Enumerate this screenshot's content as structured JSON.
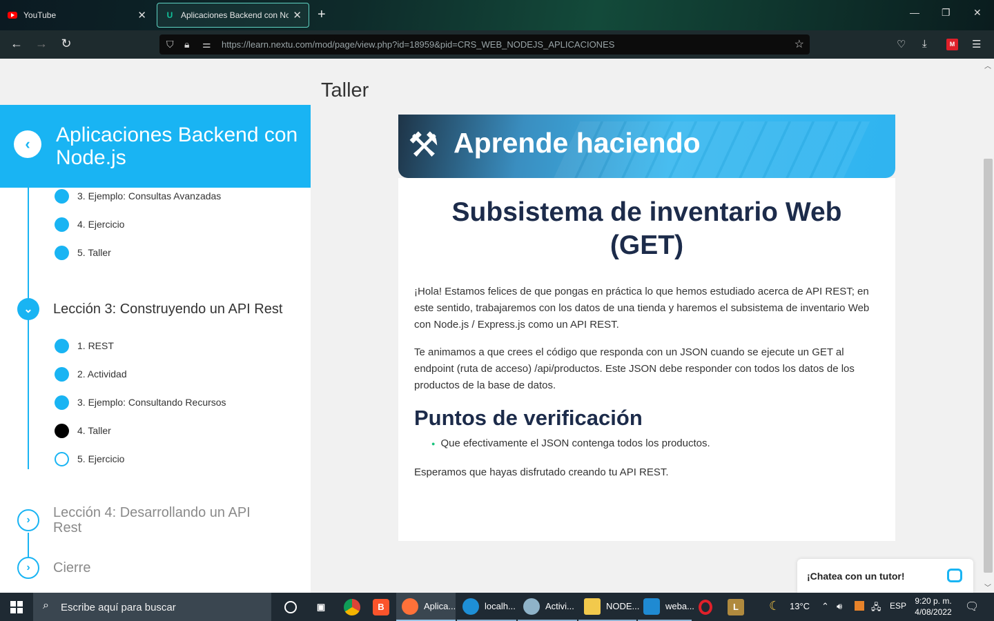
{
  "browser": {
    "tabs": [
      {
        "title": "YouTube",
        "active": false
      },
      {
        "title": "Aplicaciones Backend con Node.js",
        "active": true
      }
    ],
    "url": "https://learn.nextu.com/mod/page/view.php?id=18959&pid=CRS_WEB_NODEJS_APLICACIONES"
  },
  "page": {
    "title": "Taller"
  },
  "sidebar": {
    "course_title": "Aplicaciones Backend con Node.js",
    "prev_items": [
      {
        "label": "3. Ejemplo: Consultas Avanzadas"
      },
      {
        "label": "4. Ejercicio"
      },
      {
        "label": "5. Taller"
      }
    ],
    "lesson3": {
      "title": "Lección 3: Construyendo un API Rest",
      "items": [
        {
          "label": "1. REST",
          "state": "done"
        },
        {
          "label": "2. Actividad",
          "state": "done"
        },
        {
          "label": "3. Ejemplo: Consultando Recursos",
          "state": "done"
        },
        {
          "label": "4. Taller",
          "state": "current"
        },
        {
          "label": "5. Ejercicio",
          "state": "pending"
        }
      ]
    },
    "lesson4": {
      "title": "Lección 4: Desarrollando un API Rest"
    },
    "closing": {
      "title": "Cierre"
    }
  },
  "content": {
    "banner_title": "Aprende haciendo",
    "heading": "Subsistema de inventario Web (GET)",
    "paragraph1": "¡Hola! Estamos felices de que pongas en práctica lo que hemos estudiado acerca de API REST; en este sentido, trabajaremos con los datos de una tienda y haremos el subsistema de inventario Web con Node.js / Express.js como un API REST.",
    "paragraph2": "Te animamos a que crees el código que responda con un JSON cuando se ejecute un GET al endpoint (ruta de acceso) /api/productos. Este JSON debe responder con todos los datos de los productos de la base de datos.",
    "checkpoints_title": "Puntos de verificación",
    "checkpoints": [
      "Que efectivamente el JSON contenga todos los productos."
    ],
    "closing": "Esperamos que hayas disfrutado creando tu API REST."
  },
  "chat": {
    "label": "¡Chatea con un tutor!"
  },
  "taskbar": {
    "search_placeholder": "Escribe aquí para buscar",
    "apps": [
      {
        "label": "Aplica...",
        "icon": "firefox-icon"
      },
      {
        "label": "localh...",
        "icon": "edge-icon"
      },
      {
        "label": "Activi...",
        "icon": "paint-icon"
      },
      {
        "label": "NODE...",
        "icon": "folder-icon"
      },
      {
        "label": "weba...",
        "icon": "vscode-icon"
      }
    ],
    "weather": "13°C",
    "language": "ESP",
    "time": "9:20 p. m.",
    "date": "4/08/2022"
  },
  "colors": {
    "accent": "#19b4f3",
    "heading": "#1c2b4a",
    "check_bullet": "#19c37d"
  }
}
